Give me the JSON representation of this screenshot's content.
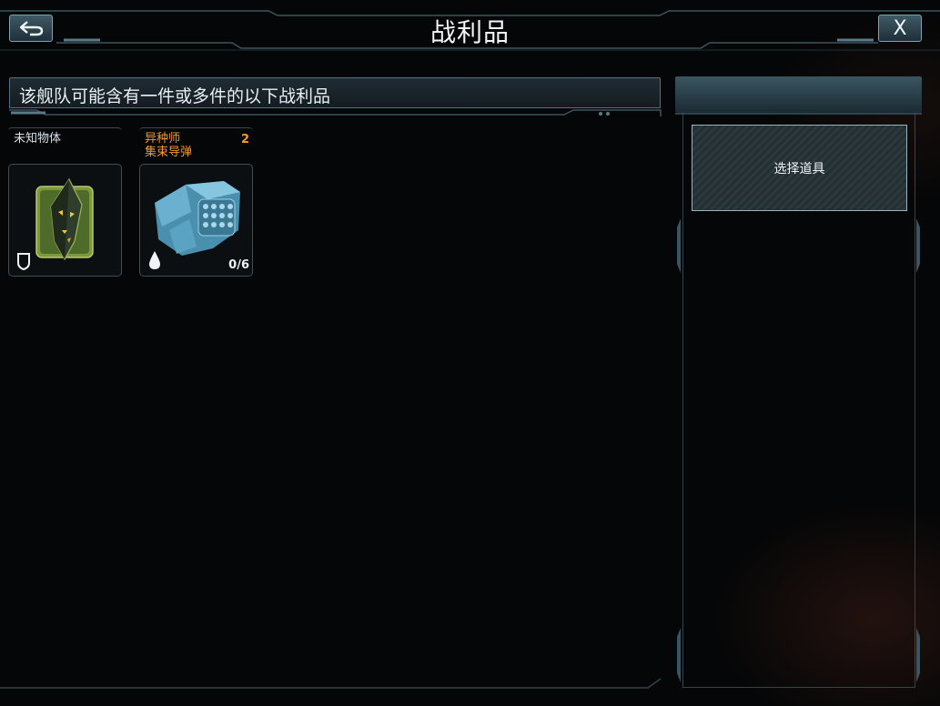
{
  "header": {
    "title": "战利品",
    "close_label": "X",
    "back_icon": "back-arrow-icon"
  },
  "banner": {
    "text": "该舰队可能含有一件或多件的以下战利品"
  },
  "loot_items": [
    {
      "name": "未知物体",
      "count": "",
      "quantity": "",
      "name_color": "#d8e2e8",
      "icon": "unknown-crystal-icon",
      "badge_icon": "shield-icon"
    },
    {
      "name_line1": "异种师",
      "name_line2": "集束导弹",
      "count": "2",
      "quantity": "0/6",
      "name_color": "#f59a2a",
      "icon": "cluster-missile-icon",
      "badge_icon": "droplet-icon"
    }
  ],
  "right_panel": {
    "select_label": "选择道具"
  },
  "colors": {
    "accent_orange": "#f59a2a",
    "frame_cyan": "#7ea2b3",
    "background": "#050607"
  }
}
